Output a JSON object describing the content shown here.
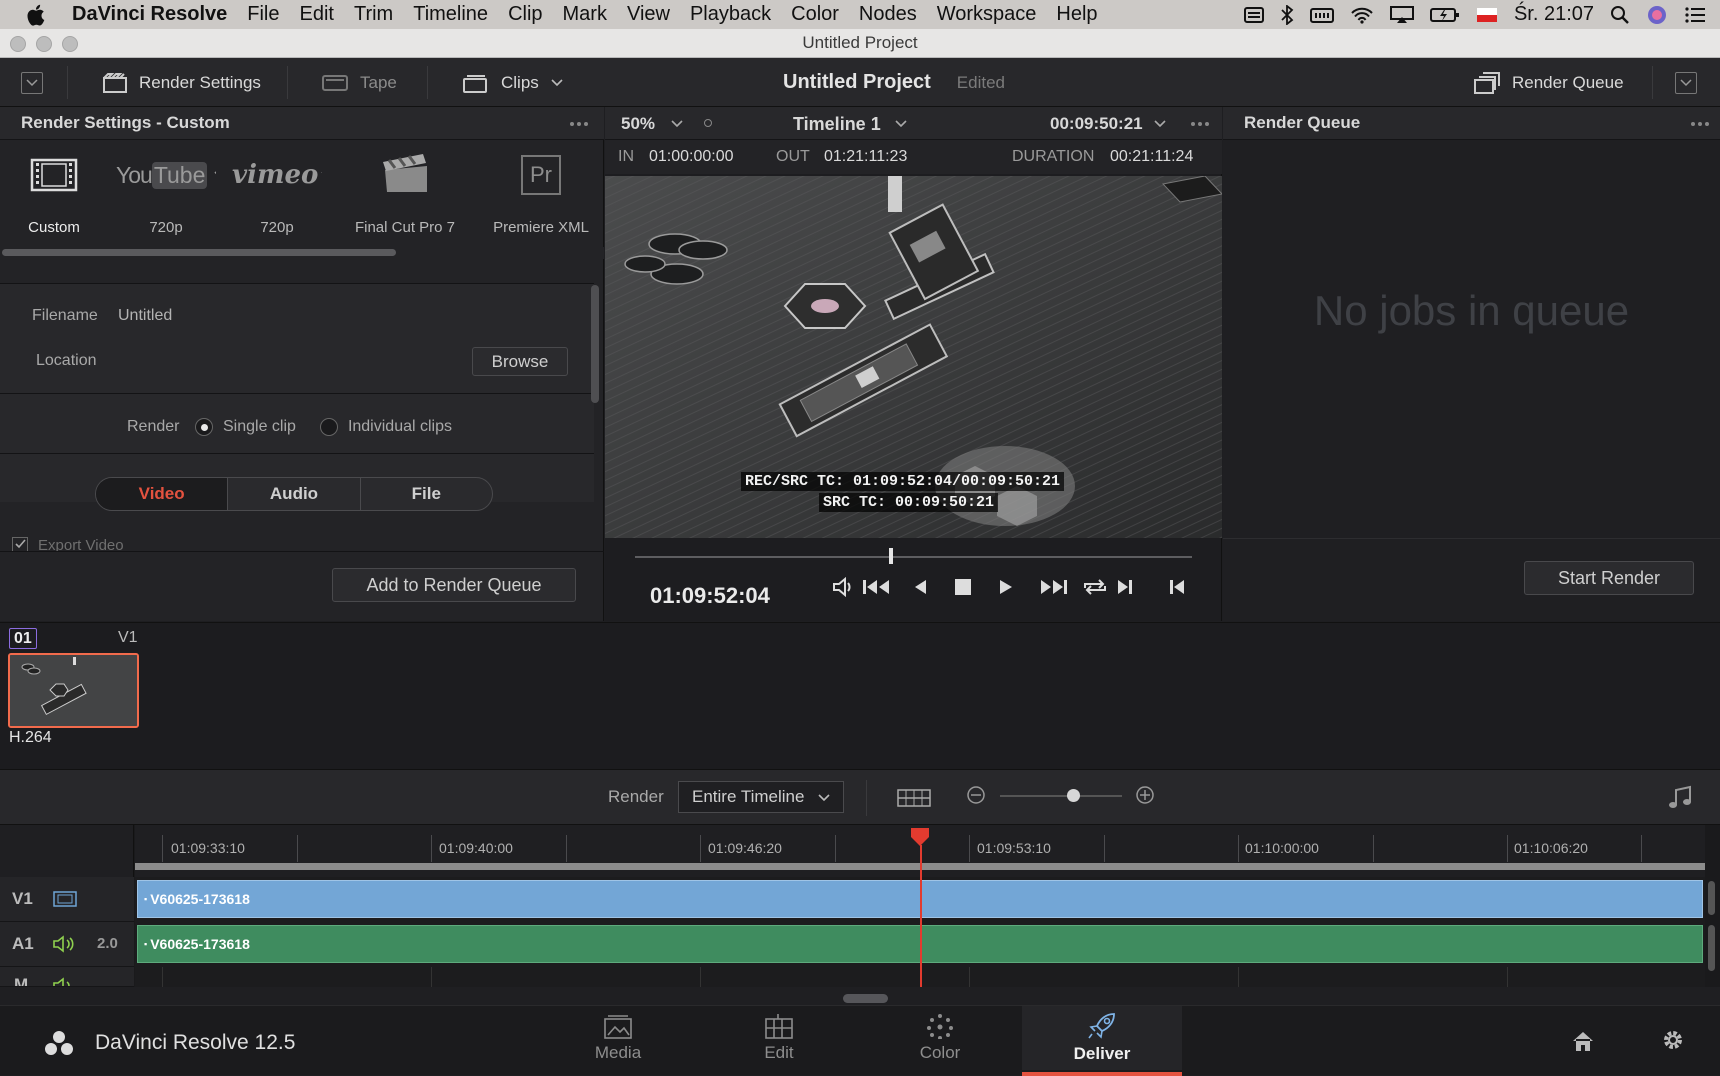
{
  "menubar": {
    "app_name": "DaVinci Resolve",
    "items": [
      "File",
      "Edit",
      "Trim",
      "Timeline",
      "Clip",
      "Mark",
      "View",
      "Playback",
      "Color",
      "Nodes",
      "Workspace",
      "Help"
    ],
    "clock": "Śr. 21:07"
  },
  "window": {
    "title": "Untitled Project"
  },
  "toolbar": {
    "render_settings": "Render Settings",
    "tape": "Tape",
    "clips": "Clips",
    "project_title": "Untitled Project",
    "project_status": "Edited",
    "render_queue": "Render Queue"
  },
  "render_settings": {
    "header": "Render Settings - Custom",
    "presets": [
      {
        "name": "Custom",
        "label": "Custom"
      },
      {
        "name": "YouTube",
        "label": "720p"
      },
      {
        "name": "vimeo",
        "label": "720p"
      },
      {
        "name": "Final Cut Pro 7",
        "label": "Final Cut Pro 7"
      },
      {
        "name": "Premiere XML",
        "label": "Premiere XML"
      }
    ],
    "youtube_logo": "You",
    "youtube_logo_b": "Tube",
    "vimeo_logo": "vimeo",
    "premiere_logo": "Pr",
    "filename_label": "Filename",
    "filename_value": "Untitled",
    "location_label": "Location",
    "browse": "Browse",
    "render_label": "Render",
    "single_clip": "Single clip",
    "individual_clips": "Individual clips",
    "tabs": [
      "Video",
      "Audio",
      "File"
    ],
    "export_video": "Export Video",
    "add_to_queue": "Add to Render Queue"
  },
  "viewer": {
    "zoom": "50%",
    "timeline_name": "Timeline 1",
    "timecode_top": "00:09:50:21",
    "in_label": "IN",
    "in_value": "01:00:00:00",
    "out_label": "OUT",
    "out_value": "01:21:11:23",
    "duration_label": "DURATION",
    "duration_value": "00:21:11:24",
    "burn_line1": "REC/SRC TC: 01:09:52:04/00:09:50:21",
    "burn_line2": "SRC TC: 00:09:50:21",
    "current_tc": "01:09:52:04",
    "scrub_position": 0.46
  },
  "render_queue": {
    "header": "Render Queue",
    "empty_text": "No jobs in queue",
    "start_render": "Start Render"
  },
  "clips_strip": {
    "clip_number": "01",
    "track": "V1",
    "codec": "H.264"
  },
  "timeline_toolbar": {
    "render_label": "Render",
    "render_range": "Entire Timeline",
    "zoom_level": 0.6
  },
  "timeline": {
    "ruler": [
      "01:09:33:10",
      "01:09:40:00",
      "01:09:46:20",
      "01:09:53:10",
      "01:10:00:00",
      "01:10:06:20"
    ],
    "tracks": [
      {
        "name": "V1",
        "clip": "V60625-173618"
      },
      {
        "name": "A1",
        "channels": "2.0",
        "clip": "V60625-173618"
      },
      {
        "name": "M"
      }
    ]
  },
  "pagebar": {
    "app_version": "DaVinci Resolve 12.5",
    "pages": [
      "Media",
      "Edit",
      "Color",
      "Deliver"
    ],
    "active_page": "Deliver"
  },
  "colors": {
    "accent": "#e4523f",
    "video_clip": "#6fa5d6",
    "audio_clip": "#3e8b5f",
    "playhead": "#e23b2f"
  }
}
